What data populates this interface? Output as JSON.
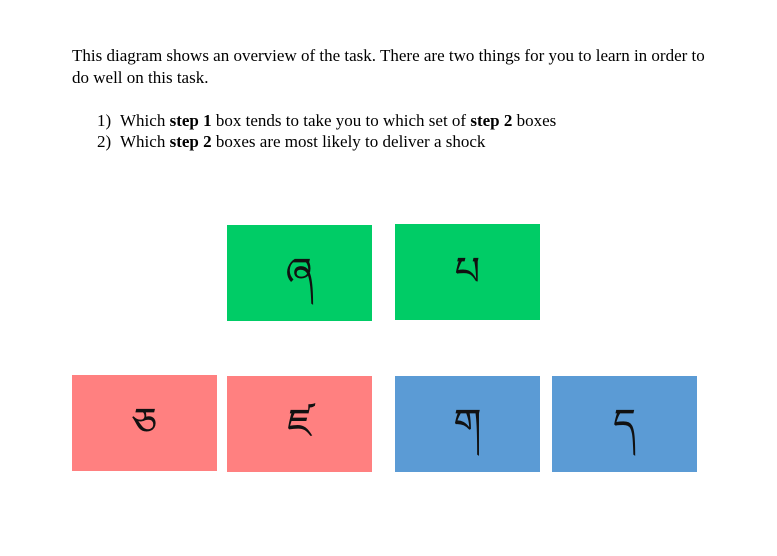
{
  "intro": {
    "text": "This diagram shows an overview of the task. There are two things for you to learn in order to do well on this task."
  },
  "steps": [
    {
      "number": "1)",
      "parts": [
        "Which ",
        "step 1",
        " box tends to take you to which set of ",
        "step 2",
        " boxes"
      ]
    },
    {
      "number": "2)",
      "parts": [
        "Which ",
        "step 2",
        " boxes are most likely to deliver a shock"
      ]
    }
  ],
  "colors": {
    "step1": "#00cc66",
    "step2_set_a": "#ff8080",
    "step2_set_b": "#5b9bd5"
  },
  "boxes": {
    "step1": [
      {
        "symbol": "ཞ"
      },
      {
        "symbol": "པ"
      }
    ],
    "step2_set_a": [
      {
        "symbol": "ཅ"
      },
      {
        "symbol": "ཛ"
      }
    ],
    "step2_set_b": [
      {
        "symbol": "ག"
      },
      {
        "symbol": "ད"
      }
    ]
  }
}
